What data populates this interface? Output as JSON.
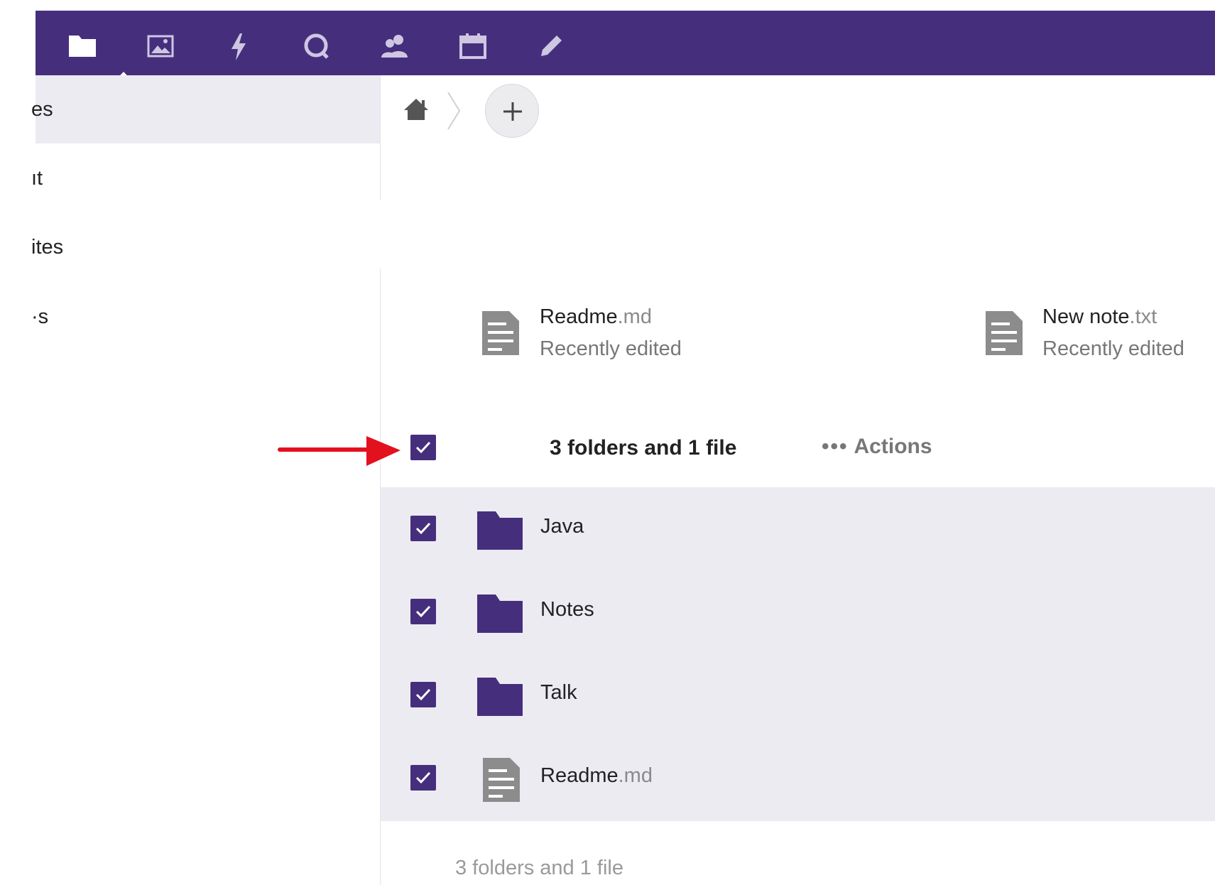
{
  "theme": {
    "primary": "#452f7d",
    "selected_row_bg": "#edebf2",
    "arrow_color": "#e3101e"
  },
  "topbar": {
    "icons": [
      "files-folder-icon",
      "photos-image-icon",
      "activity-bolt-icon",
      "search-icon",
      "contacts-icon",
      "calendar-icon",
      "notes-pencil-icon"
    ],
    "active": "files-folder-icon"
  },
  "sidebar": {
    "items": [
      {
        "label": "es",
        "active": true
      },
      {
        "label": "ıt",
        "active": false
      },
      {
        "label": "ites",
        "active": false
      },
      {
        "label": "·s",
        "active": false
      }
    ]
  },
  "breadcrumb": {
    "home_icon": "home-icon",
    "add_icon": "plus-icon"
  },
  "recent": [
    {
      "name": "Readme",
      "ext": ".md",
      "status": "Recently edited"
    },
    {
      "name": "New note",
      "ext": ".txt",
      "status": "Recently edited"
    }
  ],
  "list_header": {
    "summary": "3 folders and 1 file",
    "actions_dots": "•••",
    "actions_label": "Actions",
    "all_selected": true
  },
  "files": [
    {
      "name": "Java",
      "ext": "",
      "type": "folder",
      "selected": true
    },
    {
      "name": "Notes",
      "ext": "",
      "type": "folder",
      "selected": true
    },
    {
      "name": "Talk",
      "ext": "",
      "type": "folder",
      "selected": true
    },
    {
      "name": "Readme",
      "ext": ".md",
      "type": "file",
      "selected": true
    }
  ],
  "footer": {
    "summary": "3 folders and 1 file"
  }
}
